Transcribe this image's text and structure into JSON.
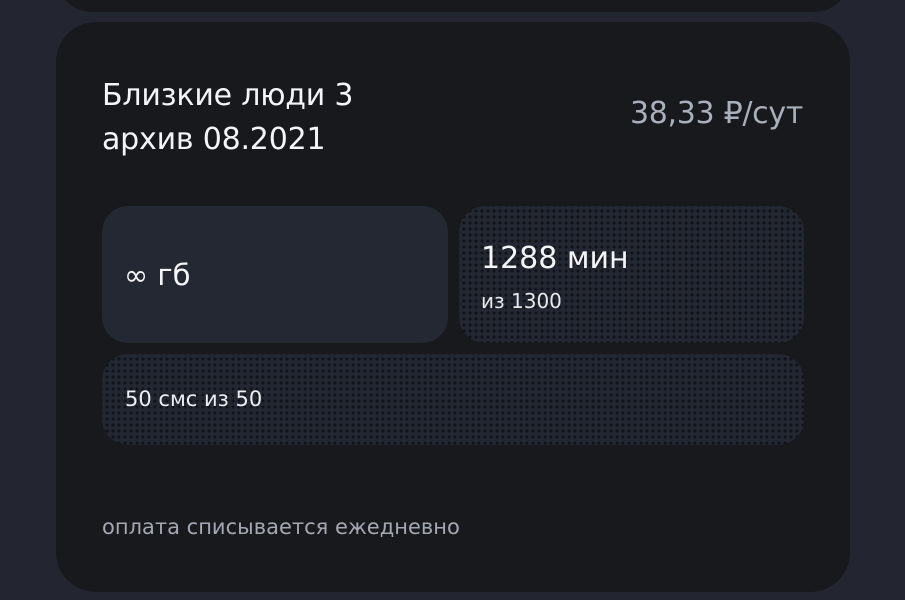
{
  "tariff": {
    "name": "Близкие люди 3",
    "archive": "архив 08.2021",
    "price": "38,33 ₽/сут",
    "data": {
      "value": "∞ гб"
    },
    "minutes": {
      "value": "1288 мин",
      "total": "из 1300"
    },
    "sms": {
      "value": "50 смс из 50"
    },
    "payment_note": "оплата списывается ежедневно"
  },
  "colors": {
    "background": "#232630",
    "card": "#17191d",
    "tile": "#242832",
    "text_primary": "#f4f5f7",
    "text_secondary": "#a9afbb"
  }
}
